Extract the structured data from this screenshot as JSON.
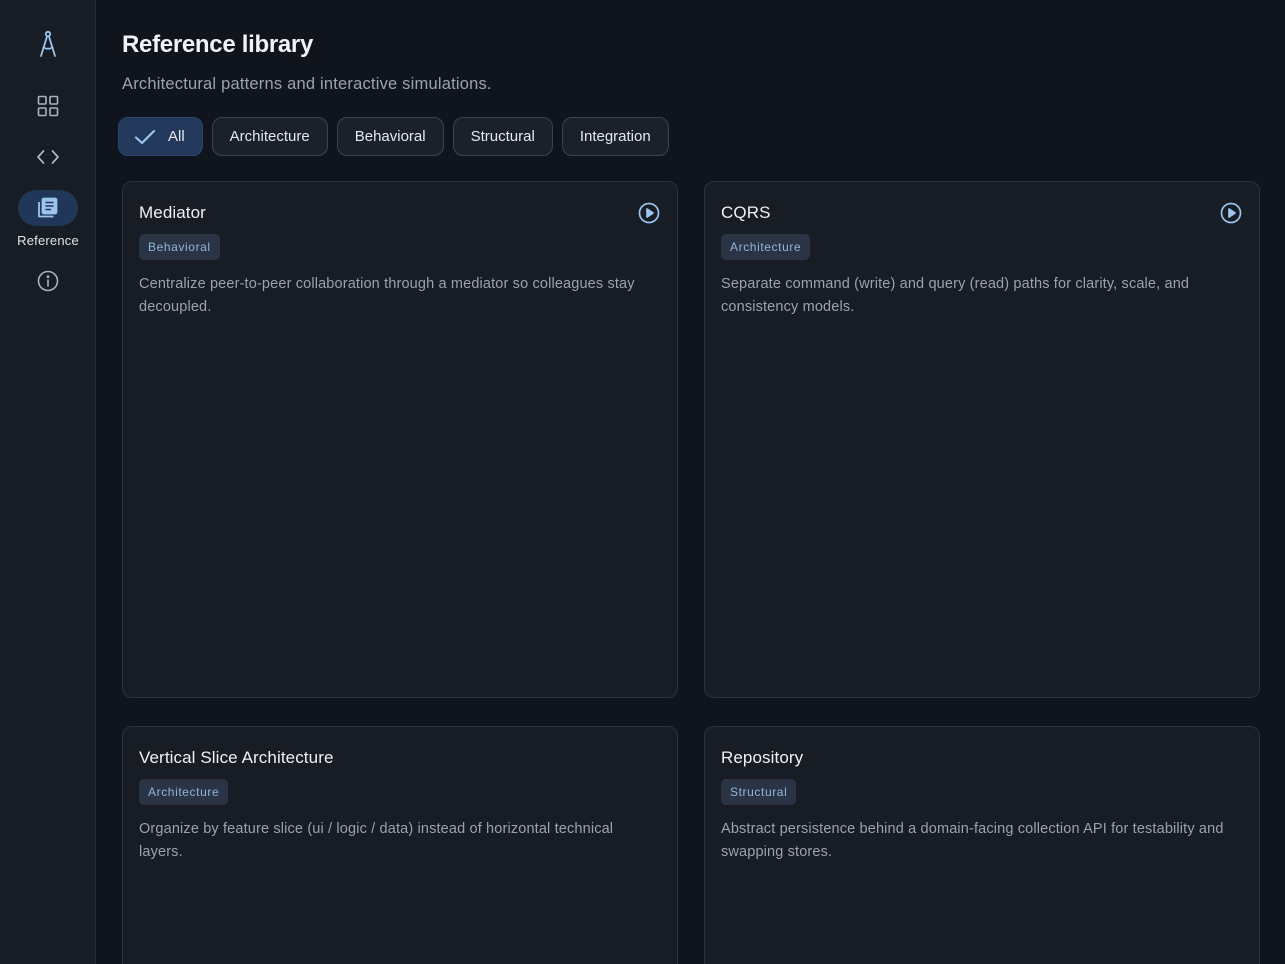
{
  "nav": {
    "items": [
      {
        "id": "logo",
        "icon": "compass-icon"
      },
      {
        "id": "dashboard",
        "icon": "grid-icon"
      },
      {
        "id": "code",
        "icon": "code-icon"
      },
      {
        "id": "reference",
        "icon": "book-icon",
        "label": "Reference",
        "active": true
      },
      {
        "id": "about",
        "icon": "info-icon"
      }
    ],
    "active_label": "Reference"
  },
  "header": {
    "title": "Reference library",
    "subtitle": "Architectural patterns and interactive simulations."
  },
  "filters": [
    {
      "label": "All",
      "selected": true
    },
    {
      "label": "Architecture",
      "selected": false
    },
    {
      "label": "Behavioral",
      "selected": false
    },
    {
      "label": "Structural",
      "selected": false
    },
    {
      "label": "Integration",
      "selected": false
    }
  ],
  "cards": [
    {
      "title": "Mediator",
      "tag": "Behavioral",
      "description": "Centralize peer-to-peer collaboration through a mediator so colleagues stay decoupled.",
      "has_simulation": true
    },
    {
      "title": "CQRS",
      "tag": "Architecture",
      "description": "Separate command (write) and query (read) paths for clarity, scale, and consistency models.",
      "has_simulation": true
    },
    {
      "title": "Vertical Slice Architecture",
      "tag": "Architecture",
      "description": "Organize by feature slice (ui / logic / data) instead of horizontal technical layers.",
      "has_simulation": false
    },
    {
      "title": "Repository",
      "tag": "Structural",
      "description": "Abstract persistence behind a domain-facing collection API for testability and swapping stores.",
      "has_simulation": false
    }
  ],
  "colors": {
    "background": "#10151d",
    "sidebar": "#171c25",
    "card": "#171c25",
    "accent": "#8fb6dc",
    "active_nav": "#20375a",
    "selected_chip": "#22395c"
  }
}
